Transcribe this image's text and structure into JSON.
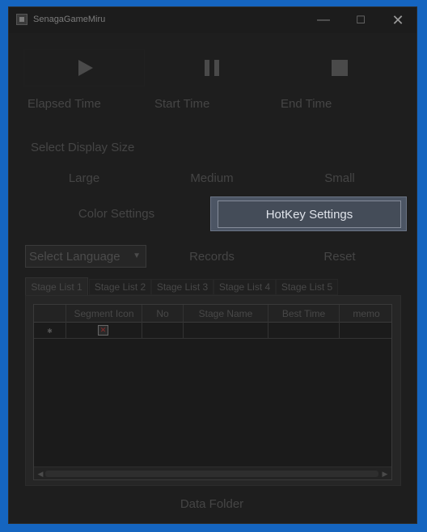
{
  "window": {
    "title": "SenagaGameMiru",
    "min_glyph": "—",
    "max_glyph": "☐",
    "close_glyph": "✕"
  },
  "controls": {
    "play_icon": "play-icon",
    "pause_icon": "pause-icon",
    "stop_icon": "stop-icon"
  },
  "times": {
    "elapsed": "Elapsed Time",
    "start": "Start Time",
    "end": "End Time"
  },
  "display_size": {
    "label": "Select Display Size",
    "large": "Large",
    "medium": "Medium",
    "small": "Small"
  },
  "settings": {
    "color": "Color Settings",
    "hotkey": "HotKey Settings"
  },
  "language": {
    "selected": "Select Language"
  },
  "actions": {
    "records": "Records",
    "reset": "Reset",
    "data_folder": "Data Folder"
  },
  "tabs": [
    "Stage List 1",
    "Stage List 2",
    "Stage List 3",
    "Stage List 4",
    "Stage List 5"
  ],
  "grid": {
    "columns": [
      "Segment Icon",
      "No",
      "Stage Name",
      "Best Time",
      "memo"
    ],
    "new_row_marker": "✱",
    "broken_image_glyph": "✕"
  },
  "colors": {
    "desktop": "#1565c0",
    "window_bg": "#1e1e1e",
    "focused_button_bg": "#444c58",
    "focused_button_text": "#dfe3ea"
  }
}
